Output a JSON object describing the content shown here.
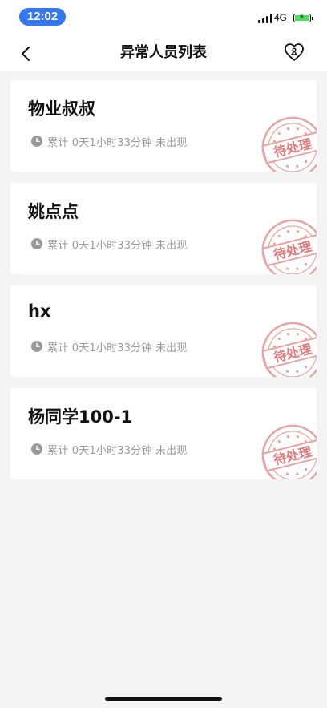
{
  "status_bar": {
    "time": "12:02",
    "network": "4G"
  },
  "nav": {
    "title": "异常人员列表",
    "back_icon": "chevron-left-icon",
    "right_icon": "heart-badge-icon"
  },
  "records": [
    {
      "name": "物业叔叔",
      "duration_text": "累计 0天1小时33分钟 未出现",
      "stamp": "待处理"
    },
    {
      "name": "姚点点",
      "duration_text": "累计 0天1小时33分钟 未出现",
      "stamp": "待处理"
    },
    {
      "name": "hx",
      "duration_text": "累计 0天1小时33分钟 未出现",
      "stamp": "待处理"
    },
    {
      "name": "杨同学100-1",
      "duration_text": "累计 0天1小时33分钟 未出现",
      "stamp": "待处理"
    }
  ],
  "colors": {
    "accent_blue": "#3478f6",
    "stamp_red": "#e07a7a",
    "meta_gray": "#9a9a9a",
    "battery_green": "#4cd964"
  }
}
